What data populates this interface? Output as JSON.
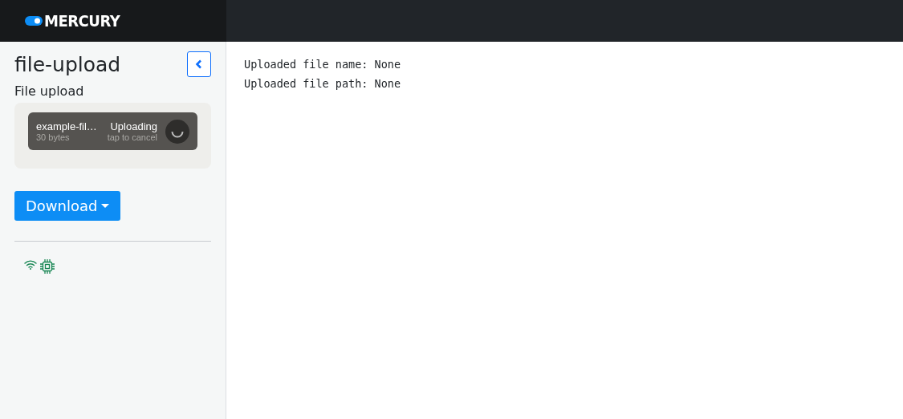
{
  "header": {
    "logo": "MERCURY"
  },
  "sidebar": {
    "title": "file-upload",
    "upload_label": "File upload",
    "upload": {
      "file_name": "example-fil…",
      "file_size": "30 bytes",
      "status": "Uploading",
      "hint": "tap to cancel"
    },
    "download_button": "Download"
  },
  "output": [
    "Uploaded file name: None",
    "Uploaded file path: None"
  ]
}
